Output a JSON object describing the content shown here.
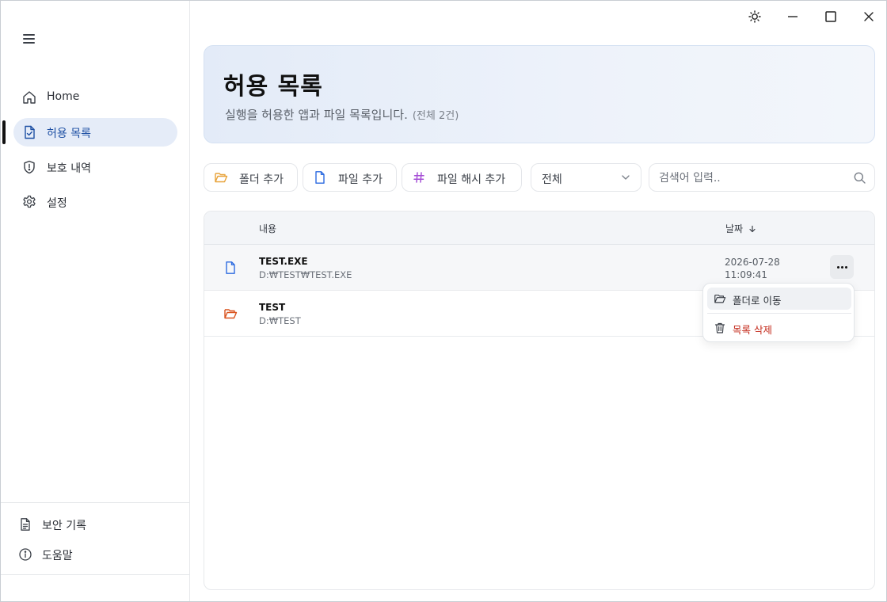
{
  "sidebar": {
    "nav": [
      {
        "label": "Home",
        "icon": "home-icon"
      },
      {
        "label": "허용 목록",
        "icon": "file-check-icon",
        "active": true
      },
      {
        "label": "보호 내역",
        "icon": "shield-icon"
      },
      {
        "label": "설정",
        "icon": "gear-icon"
      }
    ],
    "bottom": [
      {
        "label": "보안 기록",
        "icon": "document-icon"
      },
      {
        "label": "도움말",
        "icon": "info-icon"
      }
    ]
  },
  "header": {
    "title": "허용 목록",
    "subtitle": "실행을 허용한 앱과 파일 목록입니다.",
    "count": "(전체 2건)"
  },
  "toolbar": {
    "add_folder": "폴더 추가",
    "add_file": "파일 추가",
    "add_hash": "파일 해시 추가",
    "filter_value": "전체",
    "search_placeholder": "검색어 입력.."
  },
  "table": {
    "col_content": "내용",
    "col_date": "날짜",
    "rows": [
      {
        "name": "TEST.EXE",
        "path": "D:₩TEST₩TEST.EXE",
        "date": "2026-07-28",
        "time": "11:09:41",
        "type": "file"
      },
      {
        "name": "TEST",
        "path": "D:₩TEST",
        "date": "",
        "time": "",
        "type": "folder"
      }
    ]
  },
  "context_menu": {
    "open_folder": "폴더로 이동",
    "delete": "목록 삭제"
  },
  "colors": {
    "accent": "#1d4fa3",
    "active_nav_bg": "#e5ecf8",
    "folder_orange": "#e8a33a",
    "folder_red": "#d9531e",
    "file_blue": "#2d6be0",
    "hash_purple": "#a64fd6",
    "danger": "#c42b1c"
  }
}
